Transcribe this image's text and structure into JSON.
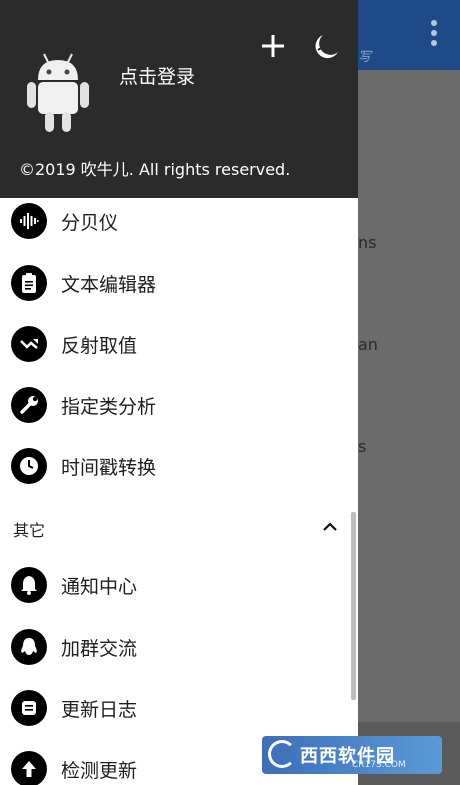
{
  "background": {
    "appbar_hint": "写",
    "fragments": [
      "ns",
      "an",
      "s"
    ]
  },
  "header": {
    "login_label": "点击登录",
    "copyright": "©2019 吹牛儿. All rights reserved."
  },
  "menu": {
    "items_top": [
      {
        "label": "分贝仪",
        "icon": "audio-wave-icon"
      },
      {
        "label": "文本编辑器",
        "icon": "clipboard-icon"
      },
      {
        "label": "反射取值",
        "icon": "trend-arrow-icon"
      },
      {
        "label": "指定类分析",
        "icon": "wrench-icon"
      },
      {
        "label": "时间戳转换",
        "icon": "clock-icon"
      }
    ],
    "section_title": "其它",
    "items_other": [
      {
        "label": "通知中心",
        "icon": "bell-icon"
      },
      {
        "label": "加群交流",
        "icon": "qq-penguin-icon"
      },
      {
        "label": "更新日志",
        "icon": "log-icon"
      },
      {
        "label": "检测更新",
        "icon": "upload-arrow-icon"
      }
    ]
  },
  "watermark": {
    "brand": "西西软件园",
    "url": "CR173.COM"
  }
}
